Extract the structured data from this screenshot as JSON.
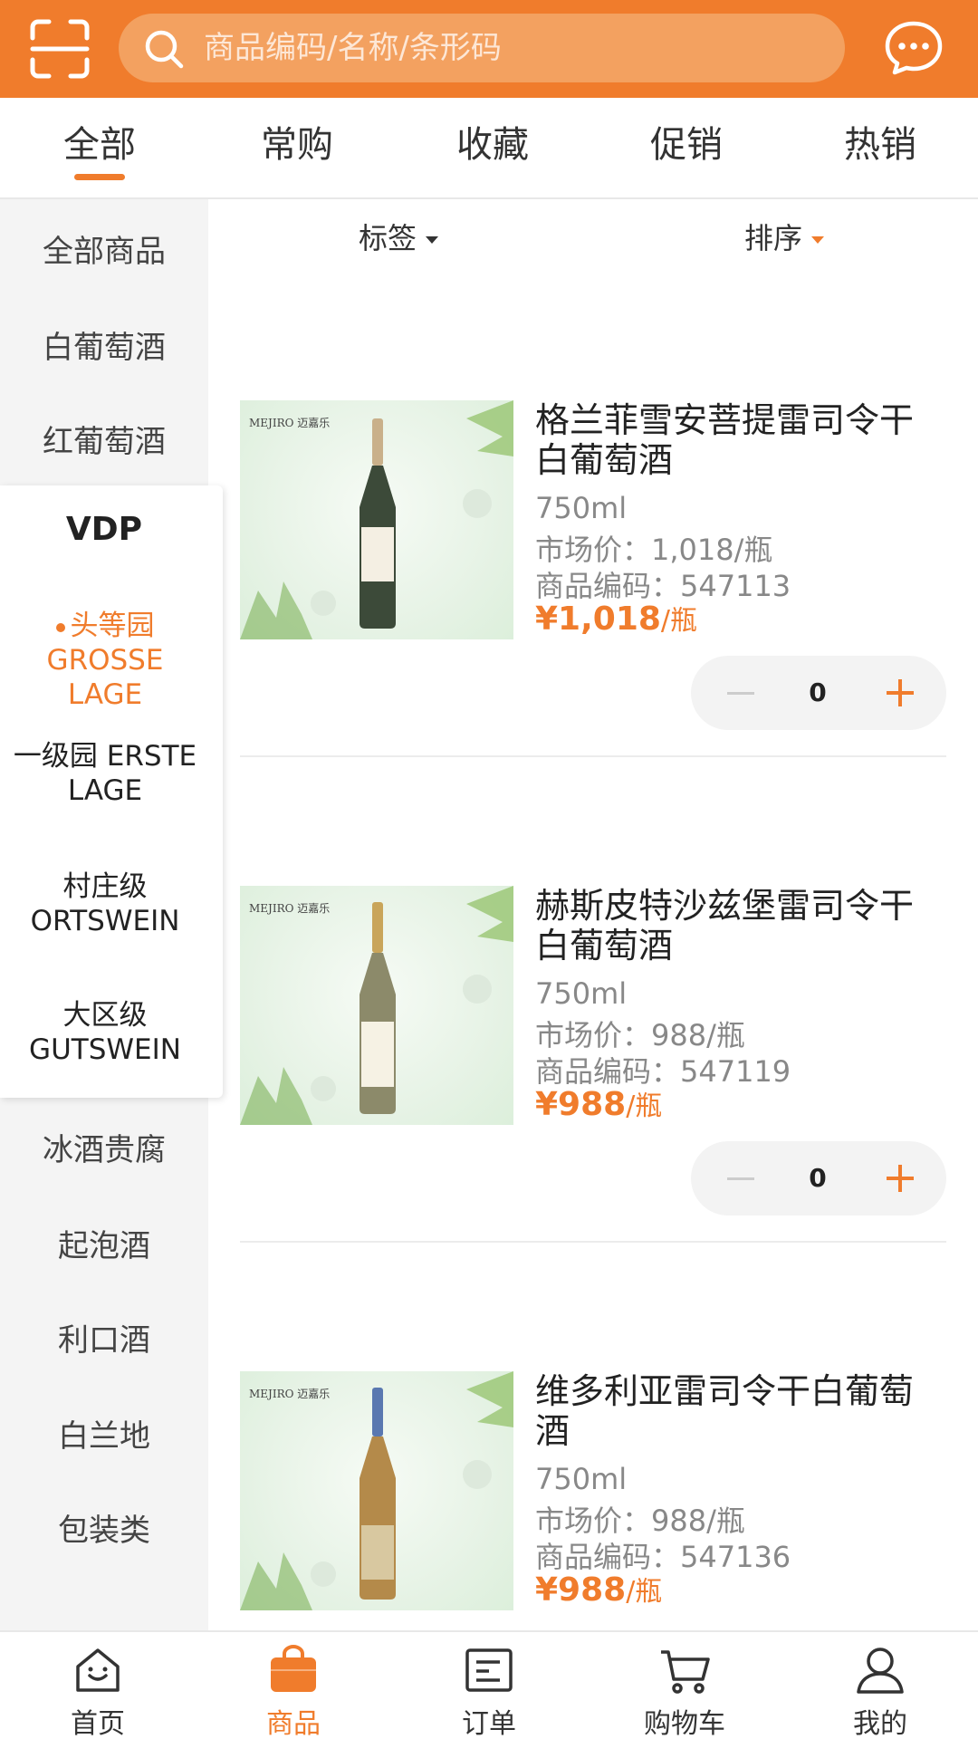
{
  "colors": {
    "accent": "#f07c2c",
    "header_bg": "#f07c2c",
    "price": "#f07c2c"
  },
  "header": {
    "scan_icon": "scan-icon",
    "search": {
      "placeholder": "商品编码/名称/条形码",
      "icon": "search-icon"
    },
    "message_icon": "chat-bubble-icon"
  },
  "tabs": [
    {
      "label": "全部",
      "active": true
    },
    {
      "label": "常购",
      "active": false
    },
    {
      "label": "收藏",
      "active": false
    },
    {
      "label": "促销",
      "active": false
    },
    {
      "label": "热销",
      "active": false
    }
  ],
  "sidebar": {
    "items": [
      "全部商品",
      "白葡萄酒",
      "红葡萄酒",
      "冰酒贵腐",
      "起泡酒",
      "利口酒",
      "白兰地",
      "包装类"
    ],
    "submenu": {
      "title": "VDP",
      "items": [
        {
          "label": "头等园 GROSSE LAGE",
          "active": true
        },
        {
          "label": "一级园 ERSTE LAGE",
          "active": false
        },
        {
          "label": "村庄级 ORTSWEIN",
          "active": false
        },
        {
          "label": "大区级 GUTSWEIN",
          "active": false
        }
      ]
    }
  },
  "filters": {
    "tag_label": "标签",
    "sort_label": "排序"
  },
  "products": [
    {
      "name": "格兰菲雪安菩提雷司令干白葡萄酒",
      "volume": "750ml",
      "market_price": "市场价：1,018/瓶",
      "code": "商品编码：547113",
      "price": "¥1,018",
      "price_unit": "/瓶",
      "quantity": "0",
      "image_brand": "MEJIRO 迈嘉乐"
    },
    {
      "name": "赫斯皮特沙兹堡雷司令干白葡萄酒",
      "volume": "750ml",
      "market_price": "市场价：988/瓶",
      "code": "商品编码：547119",
      "price": "¥988",
      "price_unit": "/瓶",
      "quantity": "0",
      "image_brand": "MEJIRO 迈嘉乐"
    },
    {
      "name": "维多利亚雷司令干白葡萄酒",
      "volume": "750ml",
      "market_price": "市场价：988/瓶",
      "code": "商品编码：547136",
      "price": "¥988",
      "price_unit": "/瓶",
      "image_brand": "MEJIRO 迈嘉乐"
    }
  ],
  "bottom_nav": [
    {
      "label": "首页",
      "icon": "home-icon",
      "active": false
    },
    {
      "label": "商品",
      "icon": "bag-icon",
      "active": true
    },
    {
      "label": "订单",
      "icon": "order-list-icon",
      "active": false
    },
    {
      "label": "购物车",
      "icon": "cart-icon",
      "active": false
    },
    {
      "label": "我的",
      "icon": "user-icon",
      "active": false
    }
  ]
}
